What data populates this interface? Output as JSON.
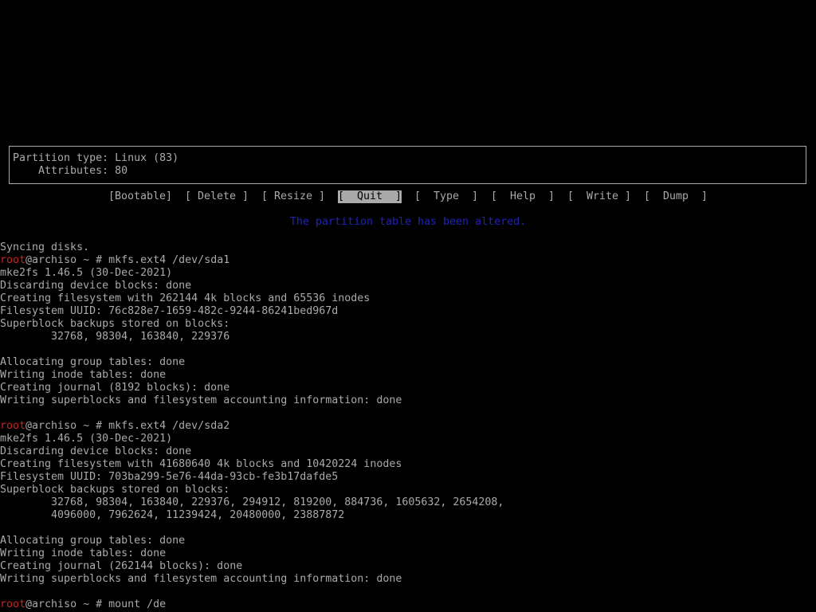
{
  "partition_info": {
    "type_line": "Partition type: Linux (83)",
    "attributes_line": "    Attributes: 80"
  },
  "menu": {
    "items": [
      {
        "label": "[Bootable]"
      },
      {
        "label": "[ Delete ]"
      },
      {
        "label": "[ Resize ]"
      },
      {
        "label": "[  Quit  ]",
        "selected": true
      },
      {
        "label": "[  Type  ]"
      },
      {
        "label": "[  Help  ]"
      },
      {
        "label": "[  Write ]"
      },
      {
        "label": "[  Dump  ]"
      }
    ]
  },
  "status_message": "The partition table has been altered.",
  "terminal": {
    "lines": [
      {
        "text": "Syncing disks."
      },
      {
        "prompt_user": "root",
        "prompt_rest": "@archiso ~ # ",
        "text": "mkfs.ext4 /dev/sda1"
      },
      {
        "text": "mke2fs 1.46.5 (30-Dec-2021)"
      },
      {
        "text": "Discarding device blocks: done"
      },
      {
        "text": "Creating filesystem with 262144 4k blocks and 65536 inodes"
      },
      {
        "text": "Filesystem UUID: 76c828e7-1659-482c-9244-86241bed967d"
      },
      {
        "text": "Superblock backups stored on blocks:"
      },
      {
        "text": "        32768, 98304, 163840, 229376"
      },
      {
        "text": ""
      },
      {
        "text": "Allocating group tables: done"
      },
      {
        "text": "Writing inode tables: done"
      },
      {
        "text": "Creating journal (8192 blocks): done"
      },
      {
        "text": "Writing superblocks and filesystem accounting information: done"
      },
      {
        "text": ""
      },
      {
        "prompt_user": "root",
        "prompt_rest": "@archiso ~ # ",
        "text": "mkfs.ext4 /dev/sda2"
      },
      {
        "text": "mke2fs 1.46.5 (30-Dec-2021)"
      },
      {
        "text": "Discarding device blocks: done"
      },
      {
        "text": "Creating filesystem with 41680640 4k blocks and 10420224 inodes"
      },
      {
        "text": "Filesystem UUID: 703ba299-5e76-44da-93cb-fe3b17dafde5"
      },
      {
        "text": "Superblock backups stored on blocks:"
      },
      {
        "text": "        32768, 98304, 163840, 229376, 294912, 819200, 884736, 1605632, 2654208,"
      },
      {
        "text": "        4096000, 7962624, 11239424, 20480000, 23887872"
      },
      {
        "text": ""
      },
      {
        "text": "Allocating group tables: done"
      },
      {
        "text": "Writing inode tables: done"
      },
      {
        "text": "Creating journal (262144 blocks): done"
      },
      {
        "text": "Writing superblocks and filesystem accounting information: done"
      },
      {
        "text": ""
      },
      {
        "prompt_user": "root",
        "prompt_rest": "@archiso ~ # ",
        "text": "mount /de"
      }
    ]
  },
  "colors": {
    "background": "#000000",
    "foreground": "#aaaaaa",
    "root_prompt": "#cc2222",
    "status_message": "#2222bb",
    "selected_menu_bg": "#aaaaaa"
  }
}
